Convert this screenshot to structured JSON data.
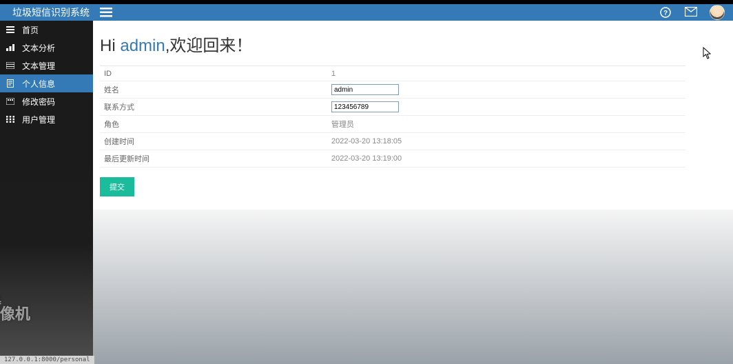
{
  "brand": "垃圾短信识别系统",
  "topbar": {
    "helpIcon": "help-icon",
    "mailIcon": "mail-icon",
    "avatar": "avatar"
  },
  "sidebar": {
    "items": [
      {
        "label": "首页",
        "icon": "menu-icon"
      },
      {
        "label": "文本分析",
        "icon": "chart-icon"
      },
      {
        "label": "文本管理",
        "icon": "list-icon"
      },
      {
        "label": "个人信息",
        "icon": "doc-icon"
      },
      {
        "label": "修改密码",
        "icon": "lock-icon"
      },
      {
        "label": "用户管理",
        "icon": "users-icon"
      }
    ],
    "activeIndex": 3
  },
  "welcome": {
    "prefix": "Hi ",
    "username": "admin",
    "suffix": ",欢迎回来！"
  },
  "form": {
    "rows": [
      {
        "label": "ID",
        "type": "text",
        "value": "1"
      },
      {
        "label": "姓名",
        "type": "input",
        "value": "admin"
      },
      {
        "label": "联系方式",
        "type": "input",
        "value": "123456789"
      },
      {
        "label": "角色",
        "type": "text",
        "value": "管理员"
      },
      {
        "label": "创建时间",
        "type": "text",
        "value": "2022-03-20 13:18:05"
      },
      {
        "label": "最后更新时间",
        "type": "text",
        "value": "2022-03-20 13:19:00"
      }
    ],
    "submitLabel": "提交"
  },
  "watermark": {
    "line1": "录制工具",
    "line2": "KK 录像机"
  },
  "cornerUrl": "127.0.0.1:8000/personal"
}
